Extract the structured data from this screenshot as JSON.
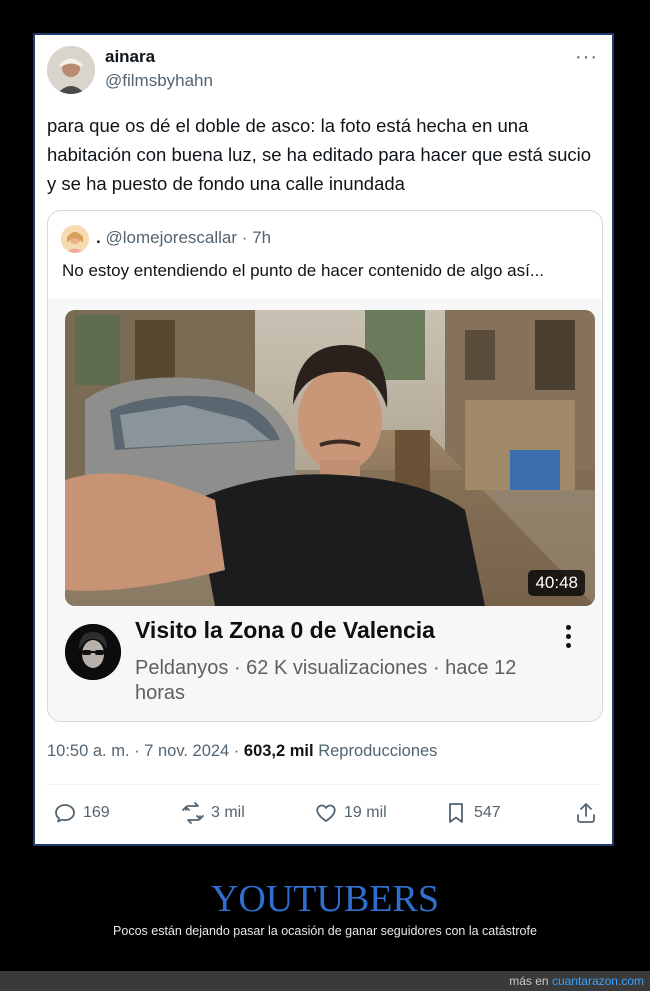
{
  "tweet": {
    "display_name": "ainara",
    "handle": "@filmsbyhahn",
    "more_label": "···",
    "text": "para que os dé el doble de asco: la foto está hecha en una habitación con buena luz, se ha editado para hacer que está sucio y se ha puesto de fondo una calle inundada",
    "quote": {
      "name": ".",
      "handle_time": "@lomejorescallar · 7h",
      "text": "No estoy entendiendo el punto de hacer contenido de algo así...",
      "video": {
        "duration": "40:48",
        "title": "Visito la Zona 0 de Valencia",
        "meta": "Peldanyos · 62 K visualizaciones · hace 12 horas"
      }
    },
    "timestamp": "10:50 a. m. · 7 nov. 2024 · ",
    "views_count": "603,2 mil",
    "views_label": " Reproducciones",
    "actions": {
      "replies": "169",
      "retweets": "3 mil",
      "likes": "19 mil",
      "bookmarks": "547"
    },
    "icons": [
      "reply-icon",
      "retweet-icon",
      "like-icon",
      "bookmark-icon",
      "share-icon"
    ]
  },
  "caption": {
    "title": "YOUTUBERS",
    "subtitle": "Pocos están dejando pasar la ocasión de ganar seguidores con la catástrofe"
  },
  "footer": {
    "prefix": "más en ",
    "site": "cuantarazon.com"
  },
  "colors": {
    "accent": "#2f6fd0",
    "text": "#0f1419",
    "muted": "#536471",
    "link": "#3aa0ff"
  }
}
